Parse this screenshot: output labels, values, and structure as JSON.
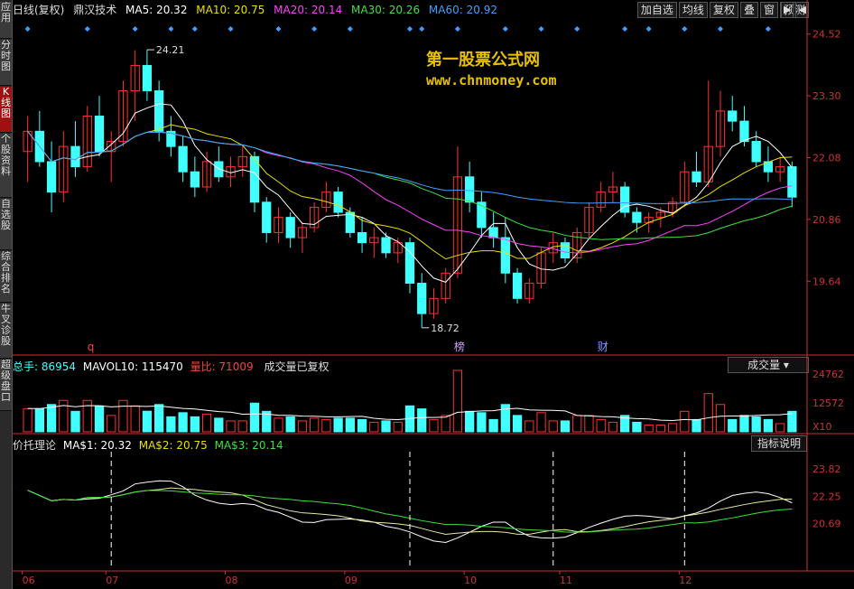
{
  "sidebar": {
    "tabs": [
      {
        "label": "应用",
        "active": false
      },
      {
        "label": "分时图",
        "active": false
      },
      {
        "label": "K线图",
        "active": true
      },
      {
        "label": "个股资料",
        "active": false
      },
      {
        "label": "自选股",
        "active": false
      },
      {
        "label": "综合排名",
        "active": false
      },
      {
        "label": "牛叉诊股",
        "active": false
      },
      {
        "label": "超级盘口",
        "active": false
      }
    ]
  },
  "header": {
    "period": "日线(复权)",
    "stock_name": "鼎汉技术",
    "ma5": "MA5: 20.32",
    "ma10": "MA10: 20.75",
    "ma20": "MA20: 20.14",
    "ma30": "MA30: 20.26",
    "ma60": "MA60: 20.92",
    "arrow": "↓"
  },
  "toolbar": {
    "buttons": [
      "加自选",
      "均线",
      "复权",
      "叠",
      "窗",
      "预测"
    ],
    "nav": [
      "▶",
      "◀"
    ]
  },
  "colors": {
    "ma5": "#ffffff",
    "ma10": "#e8e000",
    "ma20": "#ff40ff",
    "ma30": "#40e040",
    "ma60": "#40a0ff",
    "up": "#ff3030",
    "down": "#40ffff",
    "axis": "#d03030",
    "grid": "#802020"
  },
  "watermark": {
    "line1": "第一股票公式网",
    "line2": "www.chnmoney.com"
  },
  "price_panel": {
    "y_ticks": [
      "24.52",
      "23.30",
      "22.08",
      "20.86",
      "19.64"
    ],
    "high_label": "24.21",
    "low_label": "18.72",
    "markers": [
      "q",
      "榜",
      "财"
    ]
  },
  "volume_panel": {
    "title": "总手: 86954",
    "mavol": "MAVOL10: 115470",
    "ratio": "量比: 71009",
    "note": "成交量已复权",
    "dropdown": "成交量",
    "y_ticks": [
      "24762",
      "12572",
      "X10"
    ]
  },
  "indicator_panel": {
    "title": "价托理论",
    "ma1": "MA$1: 20.32",
    "ma2": "MA$2: 20.75",
    "ma3": "MA$3: 20.14",
    "explain_button": "指标说明",
    "y_ticks": [
      "23.82",
      "22.25",
      "20.69"
    ]
  },
  "x_axis": {
    "labels": [
      "06",
      "07",
      "08",
      "09",
      "10",
      "11",
      "12"
    ]
  },
  "chart_data": {
    "type": "candlestick",
    "title": "鼎汉技术 日线(复权)",
    "ylim": [
      18.2,
      24.8
    ],
    "candles": [
      [
        22.2,
        22.9,
        21.6,
        22.6
      ],
      [
        22.6,
        23.0,
        21.9,
        22.0
      ],
      [
        22.0,
        22.4,
        21.0,
        21.4
      ],
      [
        21.4,
        22.6,
        21.2,
        22.3
      ],
      [
        22.3,
        22.8,
        21.7,
        21.9
      ],
      [
        21.9,
        23.1,
        21.8,
        22.9
      ],
      [
        22.9,
        23.3,
        22.1,
        22.2
      ],
      [
        22.2,
        22.6,
        21.6,
        22.4
      ],
      [
        22.4,
        23.6,
        22.3,
        23.4
      ],
      [
        23.4,
        24.2,
        22.8,
        23.9
      ],
      [
        23.9,
        24.21,
        23.2,
        23.4
      ],
      [
        23.4,
        23.6,
        22.4,
        22.6
      ],
      [
        22.6,
        22.9,
        22.1,
        22.3
      ],
      [
        22.3,
        22.5,
        21.6,
        21.8
      ],
      [
        21.8,
        22.1,
        21.3,
        21.5
      ],
      [
        21.5,
        22.2,
        21.4,
        22.0
      ],
      [
        22.0,
        22.3,
        21.6,
        21.7
      ],
      [
        21.7,
        22.1,
        21.5,
        21.9
      ],
      [
        21.9,
        22.3,
        21.7,
        22.1
      ],
      [
        22.1,
        22.2,
        21.0,
        21.2
      ],
      [
        21.2,
        21.3,
        20.4,
        20.6
      ],
      [
        20.6,
        21.1,
        20.4,
        20.9
      ],
      [
        20.9,
        21.0,
        20.3,
        20.5
      ],
      [
        20.5,
        20.8,
        20.2,
        20.7
      ],
      [
        20.7,
        21.2,
        20.6,
        21.1
      ],
      [
        21.1,
        21.6,
        21.0,
        21.4
      ],
      [
        21.4,
        21.5,
        20.9,
        21.0
      ],
      [
        21.0,
        21.1,
        20.5,
        20.6
      ],
      [
        20.6,
        20.9,
        20.2,
        20.4
      ],
      [
        20.4,
        20.7,
        20.1,
        20.5
      ],
      [
        20.5,
        20.6,
        20.1,
        20.2
      ],
      [
        20.2,
        20.5,
        20.0,
        20.4
      ],
      [
        20.4,
        20.5,
        19.4,
        19.6
      ],
      [
        19.6,
        19.8,
        18.72,
        19.0
      ],
      [
        19.0,
        19.5,
        18.9,
        19.3
      ],
      [
        19.3,
        19.9,
        19.2,
        19.8
      ],
      [
        19.8,
        22.3,
        19.7,
        21.7
      ],
      [
        21.7,
        22.0,
        21.0,
        21.2
      ],
      [
        21.2,
        21.4,
        20.5,
        20.7
      ],
      [
        20.7,
        21.0,
        20.3,
        20.5
      ],
      [
        20.5,
        20.9,
        19.6,
        19.8
      ],
      [
        19.8,
        19.9,
        19.2,
        19.3
      ],
      [
        19.3,
        19.7,
        19.2,
        19.6
      ],
      [
        19.6,
        20.3,
        19.5,
        20.2
      ],
      [
        20.2,
        20.6,
        20.0,
        20.4
      ],
      [
        20.4,
        20.5,
        20.0,
        20.1
      ],
      [
        20.1,
        20.7,
        20.0,
        20.6
      ],
      [
        20.6,
        21.2,
        20.5,
        21.1
      ],
      [
        21.1,
        21.6,
        21.0,
        21.4
      ],
      [
        21.4,
        21.8,
        21.2,
        21.5
      ],
      [
        21.5,
        21.6,
        20.9,
        21.0
      ],
      [
        21.0,
        21.1,
        20.6,
        20.8
      ],
      [
        20.8,
        21.0,
        20.6,
        20.9
      ],
      [
        20.9,
        21.1,
        20.7,
        21.0
      ],
      [
        21.0,
        21.3,
        20.9,
        21.2
      ],
      [
        21.2,
        22.0,
        21.1,
        21.8
      ],
      [
        21.8,
        22.2,
        21.5,
        21.6
      ],
      [
        21.6,
        23.6,
        21.5,
        22.3
      ],
      [
        22.3,
        23.4,
        22.1,
        23.0
      ],
      [
        23.0,
        23.3,
        22.6,
        22.8
      ],
      [
        22.8,
        23.1,
        22.3,
        22.4
      ],
      [
        22.4,
        22.6,
        21.9,
        22.0
      ],
      [
        22.0,
        22.3,
        21.6,
        21.8
      ],
      [
        21.8,
        22.1,
        21.6,
        21.9
      ],
      [
        21.9,
        22.0,
        21.1,
        21.3
      ]
    ]
  }
}
